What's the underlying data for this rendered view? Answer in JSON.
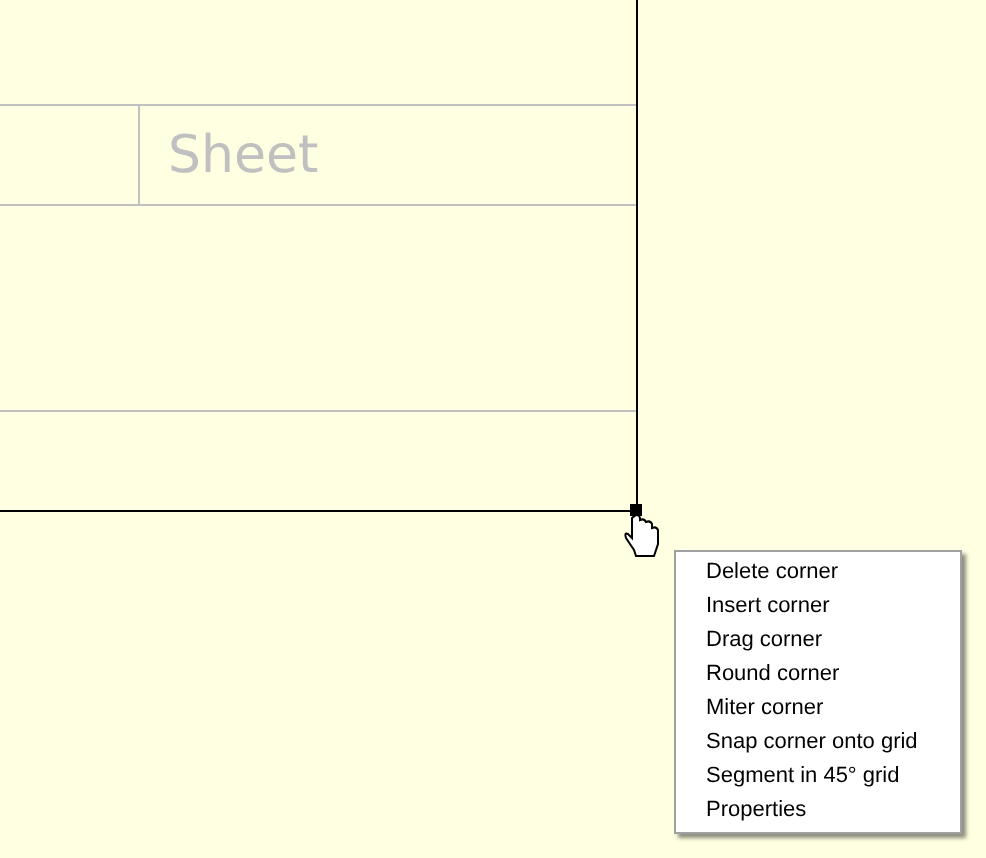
{
  "drawing": {
    "title_block_label": "Sheet"
  },
  "context_menu": {
    "items": [
      "Delete corner",
      "Insert corner",
      "Drag corner",
      "Round corner",
      "Miter corner",
      "Snap corner onto grid",
      "Segment in 45° grid",
      "Properties"
    ]
  }
}
